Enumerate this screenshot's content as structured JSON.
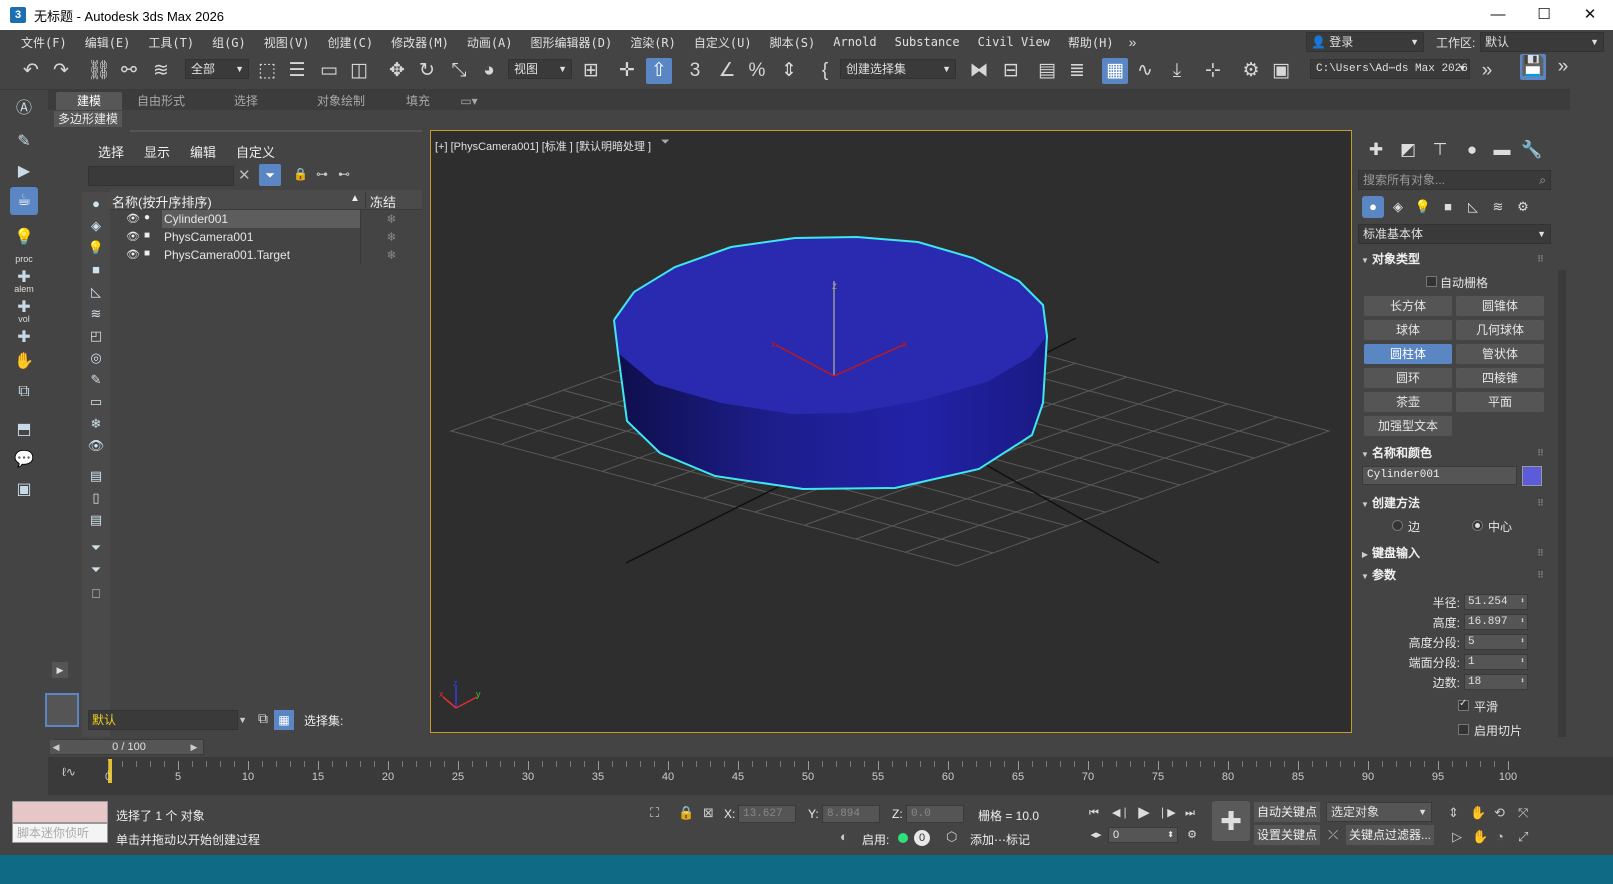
{
  "window": {
    "title": "无标题 - Autodesk 3ds Max 2026",
    "app_icon": "3",
    "minimize": "—",
    "maximize": "☐",
    "close": "✕"
  },
  "menu": {
    "items": [
      "文件(F)",
      "编辑(E)",
      "工具(T)",
      "组(G)",
      "视图(V)",
      "创建(C)",
      "修改器(M)",
      "动画(A)",
      "图形编辑器(D)",
      "渲染(R)",
      "自定义(U)",
      "脚本(S)",
      "Arnold",
      "Substance",
      "Civil View",
      "帮助(H)"
    ],
    "more": "»",
    "login": "登录",
    "workspace_label": "工作区:",
    "workspace_value": "默认"
  },
  "toolbar": {
    "selection_filter": "全部",
    "ref_coord": "视图",
    "named_selection": "创建选择集",
    "path": "C:\\Users\\Ad⋯ds Max 2026"
  },
  "ribbon": {
    "tabs": [
      "建模",
      "自由形式",
      "选择",
      "对象绘制",
      "填充"
    ],
    "sub_label": "多边形建模"
  },
  "scene_explorer": {
    "menu": [
      "选择",
      "显示",
      "编辑",
      "自定义"
    ],
    "col_name": "名称(按升序排序)",
    "col_sort": "▲",
    "col_frozen": "冻结",
    "rows": [
      {
        "name": "Cylinder001",
        "icon": "●",
        "frozen": "❄"
      },
      {
        "name": "PhysCamera001",
        "icon": "■",
        "frozen": "❄"
      },
      {
        "name": "PhysCamera001.Target",
        "icon": "■",
        "frozen": "❄"
      }
    ],
    "layer": "默认",
    "selection_set_label": "选择集:"
  },
  "viewport": {
    "label": "[+] [PhysCamera001] [标准 ] [默认明暗处理 ]",
    "object_color": "#2a2ab0",
    "selection_color": "#3ee6f0",
    "axis_z": "z",
    "axis_x": "x",
    "axis_y": "y"
  },
  "command_panel": {
    "search_placeholder": "搜索所有对象...",
    "category": "标准基本体",
    "object_type_header": "对象类型",
    "auto_grid": "自动栅格",
    "buttons": [
      "长方体",
      "圆锥体",
      "球体",
      "几何球体",
      "圆柱体",
      "管状体",
      "圆环",
      "四棱锥",
      "茶壶",
      "平面",
      "加强型文本"
    ],
    "name_color_header": "名称和颜色",
    "object_name": "Cylinder001",
    "object_color": "#5b5bdc",
    "creation_header": "创建方法",
    "creation_edge": "边",
    "creation_center": "中心",
    "keyboard_header": "键盘输入",
    "params_header": "参数",
    "params": [
      {
        "label": "半径:",
        "value": "51.254"
      },
      {
        "label": "高度:",
        "value": "16.897"
      },
      {
        "label": "高度分段:",
        "value": "5"
      },
      {
        "label": "端面分段:",
        "value": "1"
      },
      {
        "label": "边数:",
        "value": "18"
      }
    ],
    "smooth": "平滑",
    "slice": "启用切片"
  },
  "timeline": {
    "frame_display": "0 / 100",
    "current_frame": 0,
    "frame_max": 100,
    "ticks": [
      "0",
      "5",
      "10",
      "15",
      "20",
      "25",
      "30",
      "35",
      "40",
      "45",
      "50",
      "55",
      "60",
      "65",
      "70",
      "75",
      "80",
      "85",
      "90",
      "95",
      "100"
    ]
  },
  "status": {
    "maxscript_placeholder": "脚本迷你侦听",
    "selected": "选择了 1 个 对象",
    "prompt": "单击并拖动以开始创建过程",
    "x_label": "X:",
    "x_value": "13.627",
    "y_label": "Y:",
    "y_value": "8.894",
    "z_label": "Z:",
    "z_value": "0.0",
    "grid": "栅格 = 10.0",
    "enable": "启用:",
    "zero": "0",
    "add_tag": "添加⋯标记",
    "auto_key": "自动关键点",
    "selected_obj": "选定对象",
    "set_key": "设置关键点",
    "key_filter": "关键点过滤器...",
    "frame_value": "0"
  }
}
